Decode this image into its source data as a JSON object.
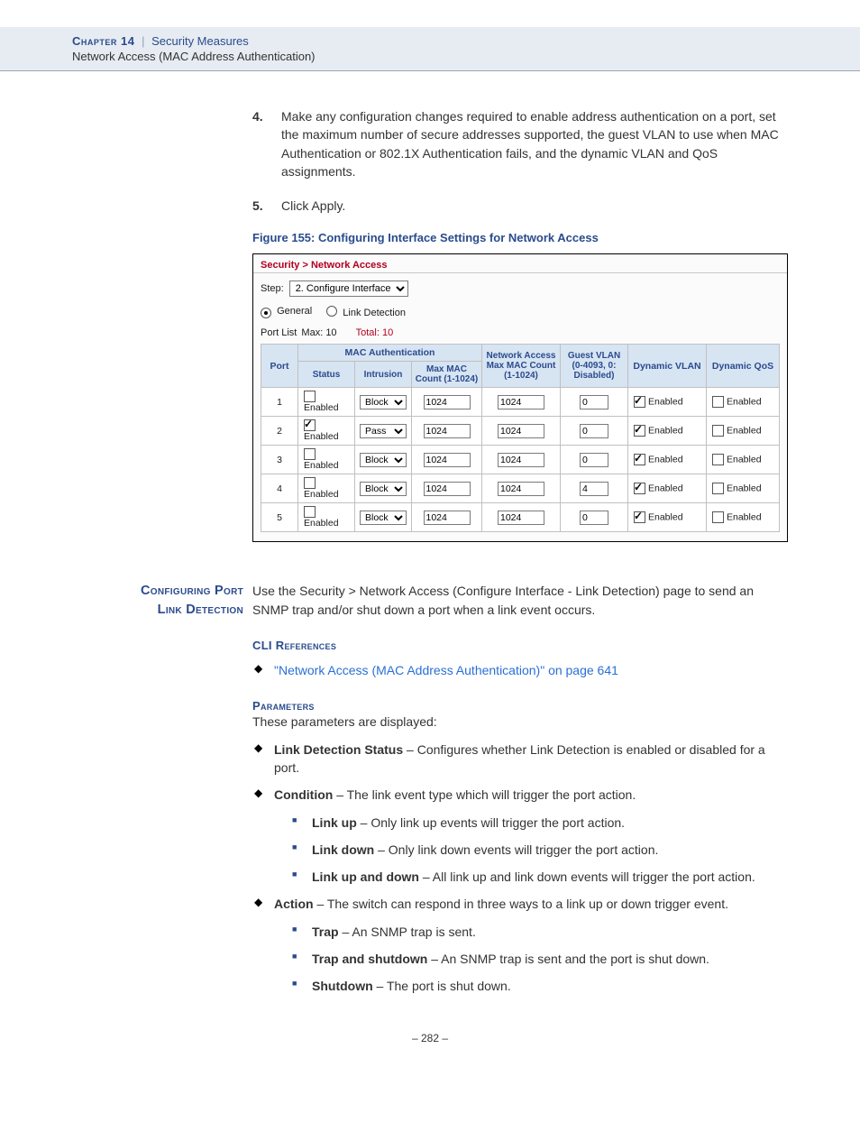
{
  "header": {
    "chapter": "Chapter 14",
    "separator": "|",
    "title": "Security Measures",
    "subtitle": "Network Access (MAC Address Authentication)"
  },
  "steps": {
    "s4_num": "4.",
    "s4_text": "Make any configuration changes required to enable address authentication on a port, set the maximum number of secure addresses supported, the guest VLAN to use when MAC Authentication or 802.1X Authentication fails, and the dynamic VLAN and QoS assignments.",
    "s5_num": "5.",
    "s5_text": "Click Apply."
  },
  "figure_caption": "Figure 155:  Configuring Interface Settings for Network Access",
  "screenshot": {
    "breadcrumb": "Security > Network Access",
    "step_label": "Step:",
    "step_value": "2. Configure Interface",
    "radio_general": "General",
    "radio_link": "Link Detection",
    "portlist_label": "Port List",
    "portlist_max": "Max: 10",
    "portlist_total": "Total: 10",
    "th_port": "Port",
    "th_mac_auth": "MAC Authentication",
    "th_status": "Status",
    "th_intrusion": "Intrusion",
    "th_maxmac": "Max MAC Count (1-1024)",
    "th_na_count": "Network Access Max MAC Count (1-1024)",
    "th_guest": "Guest VLAN (0-4093, 0: Disabled)",
    "th_dynvlan": "Dynamic VLAN",
    "th_dynqos": "Dynamic QoS",
    "enabled_label": "Enabled",
    "rows": [
      {
        "port": "1",
        "status": false,
        "intrusion": "Block",
        "maxmac": "1024",
        "nacount": "1024",
        "guest": "0",
        "dynvlan": true,
        "dynqos": false
      },
      {
        "port": "2",
        "status": true,
        "intrusion": "Pass",
        "maxmac": "1024",
        "nacount": "1024",
        "guest": "0",
        "dynvlan": true,
        "dynqos": false
      },
      {
        "port": "3",
        "status": false,
        "intrusion": "Block",
        "maxmac": "1024",
        "nacount": "1024",
        "guest": "0",
        "dynvlan": true,
        "dynqos": false
      },
      {
        "port": "4",
        "status": false,
        "intrusion": "Block",
        "maxmac": "1024",
        "nacount": "1024",
        "guest": "4",
        "dynvlan": true,
        "dynqos": false
      },
      {
        "port": "5",
        "status": false,
        "intrusion": "Block",
        "maxmac": "1024",
        "nacount": "1024",
        "guest": "0",
        "dynvlan": true,
        "dynqos": false
      }
    ]
  },
  "section": {
    "side_line1": "Configuring Port",
    "side_line2": "Link Detection",
    "intro": "Use the Security > Network Access (Configure Interface - Link Detection) page to send an SNMP trap and/or shut down a port when a link event occurs.",
    "cli_head": "CLI References",
    "cli_link": "\"Network Access (MAC Address Authentication)\" on page 641",
    "param_head": "Parameters",
    "param_intro": "These parameters are displayed:",
    "p1_b": "Link Detection Status",
    "p1_t": " – Configures whether Link Detection is enabled or disabled for a port.",
    "p2_b": "Condition",
    "p2_t": " – The link event type which will trigger the port action.",
    "p2a_b": "Link up",
    "p2a_t": " – Only link up events will trigger the port action.",
    "p2b_b": "Link down",
    "p2b_t": " – Only link down events will trigger the port action.",
    "p2c_b": "Link up and down",
    "p2c_t": " – All link up and link down events will trigger the port action.",
    "p3_b": "Action",
    "p3_t": " – The switch can respond in three ways to a link up or down trigger event.",
    "p3a_b": "Trap",
    "p3a_t": " – An SNMP trap is sent.",
    "p3b_b": "Trap and shutdown",
    "p3b_t": " – An SNMP trap is sent and the port is shut down.",
    "p3c_b": "Shutdown",
    "p3c_t": " – The port is shut down."
  },
  "footer": "–  282  –"
}
